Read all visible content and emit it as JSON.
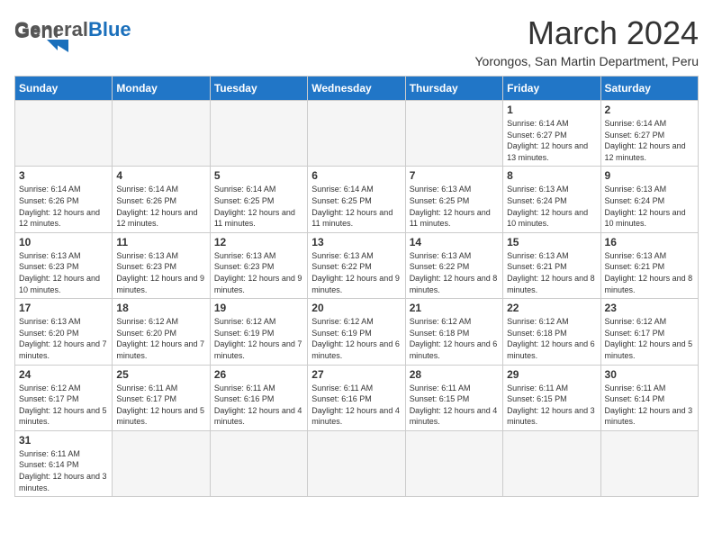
{
  "header": {
    "logo_general": "General",
    "logo_blue": "Blue",
    "month": "March 2024",
    "location": "Yorongos, San Martin Department, Peru"
  },
  "days_of_week": [
    "Sunday",
    "Monday",
    "Tuesday",
    "Wednesday",
    "Thursday",
    "Friday",
    "Saturday"
  ],
  "weeks": [
    [
      {
        "day": "",
        "info": ""
      },
      {
        "day": "",
        "info": ""
      },
      {
        "day": "",
        "info": ""
      },
      {
        "day": "",
        "info": ""
      },
      {
        "day": "",
        "info": ""
      },
      {
        "day": "1",
        "info": "Sunrise: 6:14 AM\nSunset: 6:27 PM\nDaylight: 12 hours and 13 minutes."
      },
      {
        "day": "2",
        "info": "Sunrise: 6:14 AM\nSunset: 6:27 PM\nDaylight: 12 hours and 12 minutes."
      }
    ],
    [
      {
        "day": "3",
        "info": "Sunrise: 6:14 AM\nSunset: 6:26 PM\nDaylight: 12 hours and 12 minutes."
      },
      {
        "day": "4",
        "info": "Sunrise: 6:14 AM\nSunset: 6:26 PM\nDaylight: 12 hours and 12 minutes."
      },
      {
        "day": "5",
        "info": "Sunrise: 6:14 AM\nSunset: 6:25 PM\nDaylight: 12 hours and 11 minutes."
      },
      {
        "day": "6",
        "info": "Sunrise: 6:14 AM\nSunset: 6:25 PM\nDaylight: 12 hours and 11 minutes."
      },
      {
        "day": "7",
        "info": "Sunrise: 6:13 AM\nSunset: 6:25 PM\nDaylight: 12 hours and 11 minutes."
      },
      {
        "day": "8",
        "info": "Sunrise: 6:13 AM\nSunset: 6:24 PM\nDaylight: 12 hours and 10 minutes."
      },
      {
        "day": "9",
        "info": "Sunrise: 6:13 AM\nSunset: 6:24 PM\nDaylight: 12 hours and 10 minutes."
      }
    ],
    [
      {
        "day": "10",
        "info": "Sunrise: 6:13 AM\nSunset: 6:23 PM\nDaylight: 12 hours and 10 minutes."
      },
      {
        "day": "11",
        "info": "Sunrise: 6:13 AM\nSunset: 6:23 PM\nDaylight: 12 hours and 9 minutes."
      },
      {
        "day": "12",
        "info": "Sunrise: 6:13 AM\nSunset: 6:23 PM\nDaylight: 12 hours and 9 minutes."
      },
      {
        "day": "13",
        "info": "Sunrise: 6:13 AM\nSunset: 6:22 PM\nDaylight: 12 hours and 9 minutes."
      },
      {
        "day": "14",
        "info": "Sunrise: 6:13 AM\nSunset: 6:22 PM\nDaylight: 12 hours and 8 minutes."
      },
      {
        "day": "15",
        "info": "Sunrise: 6:13 AM\nSunset: 6:21 PM\nDaylight: 12 hours and 8 minutes."
      },
      {
        "day": "16",
        "info": "Sunrise: 6:13 AM\nSunset: 6:21 PM\nDaylight: 12 hours and 8 minutes."
      }
    ],
    [
      {
        "day": "17",
        "info": "Sunrise: 6:13 AM\nSunset: 6:20 PM\nDaylight: 12 hours and 7 minutes."
      },
      {
        "day": "18",
        "info": "Sunrise: 6:12 AM\nSunset: 6:20 PM\nDaylight: 12 hours and 7 minutes."
      },
      {
        "day": "19",
        "info": "Sunrise: 6:12 AM\nSunset: 6:19 PM\nDaylight: 12 hours and 7 minutes."
      },
      {
        "day": "20",
        "info": "Sunrise: 6:12 AM\nSunset: 6:19 PM\nDaylight: 12 hours and 6 minutes."
      },
      {
        "day": "21",
        "info": "Sunrise: 6:12 AM\nSunset: 6:18 PM\nDaylight: 12 hours and 6 minutes."
      },
      {
        "day": "22",
        "info": "Sunrise: 6:12 AM\nSunset: 6:18 PM\nDaylight: 12 hours and 6 minutes."
      },
      {
        "day": "23",
        "info": "Sunrise: 6:12 AM\nSunset: 6:17 PM\nDaylight: 12 hours and 5 minutes."
      }
    ],
    [
      {
        "day": "24",
        "info": "Sunrise: 6:12 AM\nSunset: 6:17 PM\nDaylight: 12 hours and 5 minutes."
      },
      {
        "day": "25",
        "info": "Sunrise: 6:11 AM\nSunset: 6:17 PM\nDaylight: 12 hours and 5 minutes."
      },
      {
        "day": "26",
        "info": "Sunrise: 6:11 AM\nSunset: 6:16 PM\nDaylight: 12 hours and 4 minutes."
      },
      {
        "day": "27",
        "info": "Sunrise: 6:11 AM\nSunset: 6:16 PM\nDaylight: 12 hours and 4 minutes."
      },
      {
        "day": "28",
        "info": "Sunrise: 6:11 AM\nSunset: 6:15 PM\nDaylight: 12 hours and 4 minutes."
      },
      {
        "day": "29",
        "info": "Sunrise: 6:11 AM\nSunset: 6:15 PM\nDaylight: 12 hours and 3 minutes."
      },
      {
        "day": "30",
        "info": "Sunrise: 6:11 AM\nSunset: 6:14 PM\nDaylight: 12 hours and 3 minutes."
      }
    ],
    [
      {
        "day": "31",
        "info": "Sunrise: 6:11 AM\nSunset: 6:14 PM\nDaylight: 12 hours and 3 minutes."
      },
      {
        "day": "",
        "info": ""
      },
      {
        "day": "",
        "info": ""
      },
      {
        "day": "",
        "info": ""
      },
      {
        "day": "",
        "info": ""
      },
      {
        "day": "",
        "info": ""
      },
      {
        "day": "",
        "info": ""
      }
    ]
  ]
}
